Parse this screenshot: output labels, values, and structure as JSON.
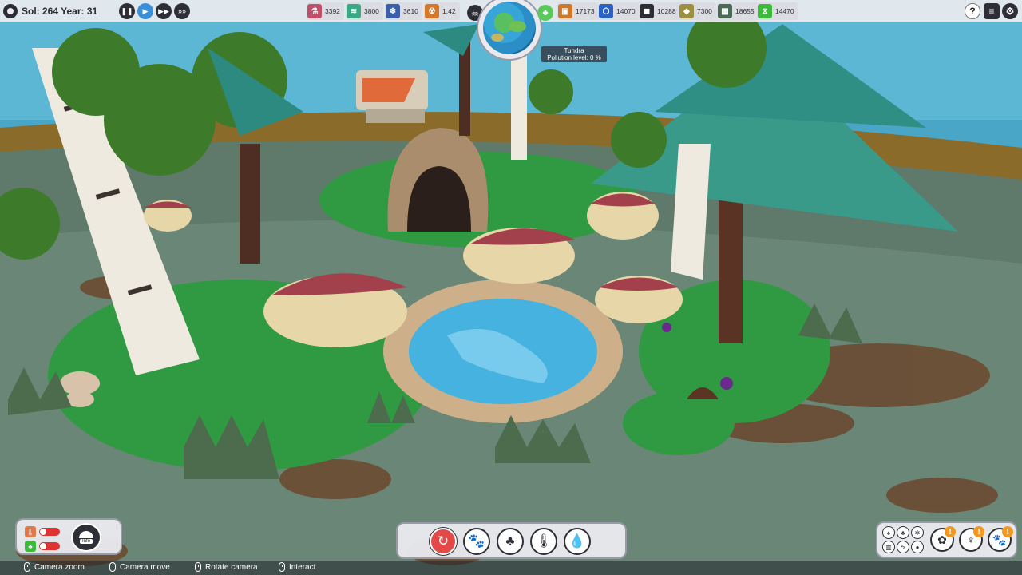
{
  "hud": {
    "sol_label": "Sol: 264 Year: 31",
    "resources": [
      {
        "icon": "flask-icon",
        "color": "#c0506a",
        "value": "3392"
      },
      {
        "icon": "water-layers-icon",
        "color": "#3aa882",
        "value": "3800"
      },
      {
        "icon": "ice-icon",
        "color": "#3a5fa8",
        "value": "3610"
      },
      {
        "icon": "radiation-icon",
        "color": "#d5782a",
        "value": "1.42"
      },
      {
        "icon": "crate-icon",
        "color": "#d0782a",
        "value": "17173"
      },
      {
        "icon": "molecule-icon",
        "color": "#2a62c8",
        "value": "14070"
      },
      {
        "icon": "stone-icon",
        "color": "#2e2e36",
        "value": "10288"
      },
      {
        "icon": "ore-icon",
        "color": "#9c9040",
        "value": "7300"
      },
      {
        "icon": "circuit-icon",
        "color": "#4a6a56",
        "value": "18655"
      },
      {
        "icon": "dna-icon",
        "color": "#3cba3c",
        "value": "14470"
      }
    ]
  },
  "biome": {
    "name": "Tundra",
    "pollution": "Pollution level: 0 %"
  },
  "info_panel": {
    "info_label": "Info"
  },
  "hints": [
    {
      "label": "Camera zoom"
    },
    {
      "label": "Camera move"
    },
    {
      "label": "Rotate camera"
    },
    {
      "label": "Interact"
    }
  ],
  "colors": {
    "accent_blue": "#3b8ed8",
    "alert_orange": "#f39a1e",
    "active_red": "#e24a4a"
  }
}
